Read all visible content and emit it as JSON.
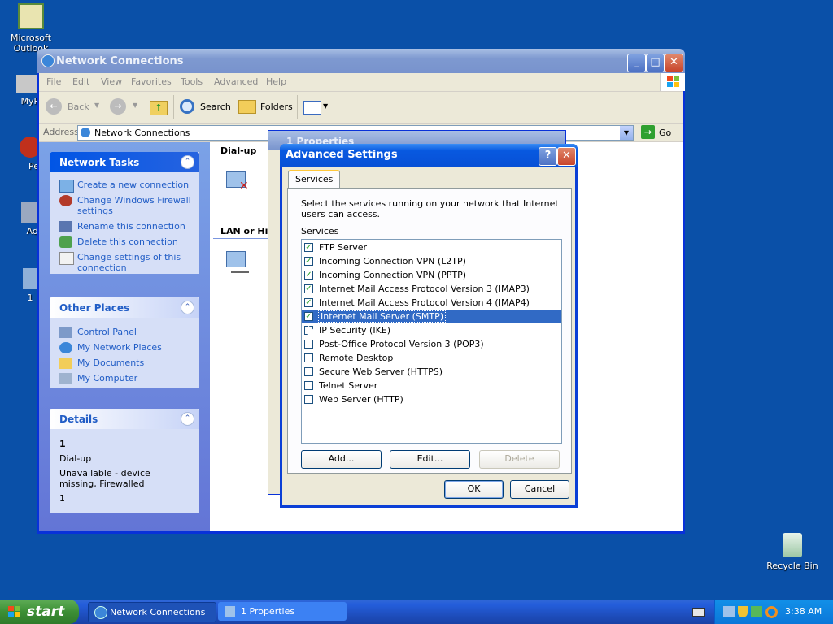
{
  "desktop": {
    "icons": [
      {
        "label": "Microsoft\nOutlook"
      },
      {
        "label": "MyPa"
      },
      {
        "label": "Peg"
      },
      {
        "label": "Adm"
      },
      {
        "label": "1"
      },
      {
        "label": "Recycle Bin"
      }
    ]
  },
  "window": {
    "title": "Network Connections",
    "menu": [
      "File",
      "Edit",
      "View",
      "Favorites",
      "Tools",
      "Advanced",
      "Help"
    ],
    "toolbar": {
      "back": "Back",
      "search": "Search",
      "folders": "Folders"
    },
    "address": {
      "label": "Address",
      "value": "Network Connections",
      "go": "Go"
    },
    "sections": {
      "dialup": "Dial-up",
      "lan": "LAN or Hig"
    },
    "network_tasks": {
      "title": "Network Tasks",
      "items": [
        "Create a new connection",
        "Change Windows Firewall settings",
        "Rename this connection",
        "Delete this connection",
        "Change settings of this connection"
      ]
    },
    "other_places": {
      "title": "Other Places",
      "items": [
        "Control Panel",
        "My Network Places",
        "My Documents",
        "My Computer"
      ]
    },
    "details": {
      "title": "Details",
      "name": "1",
      "type": "Dial-up",
      "status": "Unavailable - device missing, Firewalled",
      "extra": "1"
    }
  },
  "properties_dialog": {
    "title": "1 Properties"
  },
  "advanced_dialog": {
    "title": "Advanced Settings",
    "tab": "Services",
    "description": "Select the services running on your network that Internet users can access.",
    "list_label": "Services",
    "services": [
      {
        "name": "FTP Server",
        "checked": true
      },
      {
        "name": "Incoming Connection VPN (L2TP)",
        "checked": true
      },
      {
        "name": "Incoming Connection VPN (PPTP)",
        "checked": true
      },
      {
        "name": "Internet Mail Access Protocol Version 3 (IMAP3)",
        "checked": true
      },
      {
        "name": "Internet Mail Access Protocol Version 4 (IMAP4)",
        "checked": true
      },
      {
        "name": "Internet Mail Server (SMTP)",
        "checked": true,
        "selected": true
      },
      {
        "name": "IP Security (IKE)",
        "checked": false
      },
      {
        "name": "Post-Office Protocol Version 3 (POP3)",
        "checked": false
      },
      {
        "name": "Remote Desktop",
        "checked": false
      },
      {
        "name": "Secure Web Server (HTTPS)",
        "checked": false
      },
      {
        "name": "Telnet Server",
        "checked": false
      },
      {
        "name": "Web Server (HTTP)",
        "checked": false
      }
    ],
    "buttons": {
      "add": "Add...",
      "edit": "Edit...",
      "delete": "Delete",
      "ok": "OK",
      "cancel": "Cancel"
    }
  },
  "taskbar": {
    "start": "start",
    "tasks": [
      "Network Connections",
      "1 Properties"
    ],
    "clock": "3:38 AM"
  }
}
